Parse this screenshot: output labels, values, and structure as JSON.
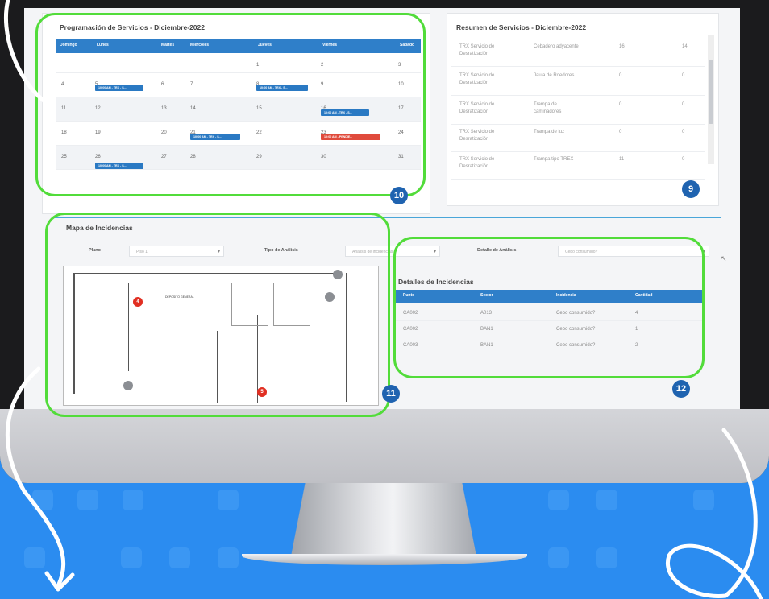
{
  "calendar": {
    "title": "Programación de Servicios - Diciembre-2022",
    "days": [
      "Domingo",
      "Lunes",
      "Martes",
      "Miércoles",
      "Jueves",
      "Viernes",
      "Sábado"
    ],
    "weeks": [
      [
        "",
        "",
        "",
        "",
        "1",
        "2",
        "3"
      ],
      [
        "4",
        "5",
        "6",
        "7",
        "8",
        "9",
        "10"
      ],
      [
        "11",
        "12",
        "13",
        "14",
        "15",
        "16",
        "17"
      ],
      [
        "18",
        "19",
        "20",
        "21",
        "22",
        "23",
        "24"
      ],
      [
        "25",
        "26",
        "27",
        "28",
        "29",
        "30",
        "31"
      ]
    ],
    "events": [
      {
        "label": "10:00 AM - TRX - S..."
      },
      {
        "label": "10:00 AM - TRX - S..."
      },
      {
        "label": "10:00 AM - TRX - S..."
      },
      {
        "label": "10:00 AM - TRX - S..."
      },
      {
        "label": "10:00 AM - PENDIE..."
      },
      {
        "label": "10:00 AM - TRX - S..."
      }
    ]
  },
  "summary": {
    "title": "Resumen de Servicios - Diciembre-2022",
    "rows": [
      {
        "service": "TRX Servicio de Desratización",
        "device": "Cebadero adyacente",
        "a": "16",
        "b": "14"
      },
      {
        "service": "TRX Servicio de Desratización",
        "device": "Jaula de Roedores",
        "a": "0",
        "b": "0"
      },
      {
        "service": "TRX Servicio de Desratización",
        "device": "Trampa de caminadores",
        "a": "0",
        "b": "0"
      },
      {
        "service": "TRX Servicio de Desratización",
        "device": "Trampa de luz",
        "a": "0",
        "b": "0"
      },
      {
        "service": "TRX Servicio de Desratización",
        "device": "Trampa tipo TREX",
        "a": "11",
        "b": "0"
      }
    ]
  },
  "map": {
    "title": "Mapa de Incidencias",
    "plano_label": "Plano",
    "plano_value": "Piso 1",
    "tipo_label": "Tipo de Análisis",
    "tipo_value": "Análisis de incidencias",
    "detalle_label": "Detalle de Análisis",
    "detalle_value": "Cebo consumido?",
    "pins": [
      "4",
      "5"
    ],
    "room_label": "DEPOSITO GENERAL"
  },
  "details": {
    "title": "Detalles de Incidencias",
    "headers": [
      "Punto",
      "Sector",
      "Incidencia",
      "Cantidad"
    ],
    "rows": [
      [
        "CA002",
        "A013",
        "Cebo consumido?",
        "4"
      ],
      [
        "CA002",
        "BAN1",
        "Cebo consumido?",
        "1"
      ],
      [
        "CA003",
        "BAN1",
        "Cebo consumido?",
        "2"
      ]
    ]
  },
  "badges": [
    "10",
    "9",
    "11",
    "12"
  ],
  "colors": {
    "background": "#2b8cf0",
    "highlight": "#52dc3a",
    "table_header": "#2f7fc9",
    "badge": "#1f63b0",
    "pin": "#e12f22"
  }
}
